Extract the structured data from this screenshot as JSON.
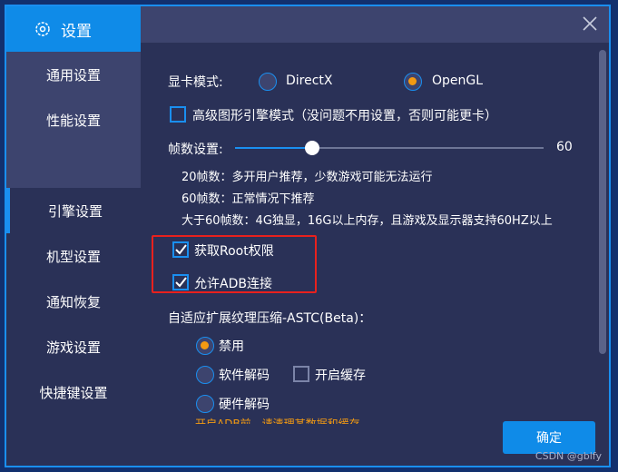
{
  "sidebar": {
    "title": "设置",
    "title_icon": "gear-icon",
    "items": [
      {
        "label": "通用设置"
      },
      {
        "label": "性能设置"
      },
      {
        "label": "引擎设置",
        "selected": true
      },
      {
        "label": "机型设置"
      },
      {
        "label": "通知恢复"
      },
      {
        "label": "游戏设置"
      },
      {
        "label": "快捷键设置"
      }
    ]
  },
  "main": {
    "gpu_mode": {
      "label": "显卡模式:",
      "options": [
        "DirectX",
        "OpenGL"
      ],
      "selected": "OpenGL"
    },
    "advanced_engine": {
      "label": "高级图形引擎模式（没问题不用设置，否则可能更卡）",
      "checked": false
    },
    "fps": {
      "label": "帧数设置:",
      "value": "60",
      "notes": [
        "20帧数：多开用户推荐，少数游戏可能无法运行",
        "60帧数：正常情况下推荐",
        "大于60帧数：4G独显，16G以上内存，且游戏及显示器支持60HZ以上"
      ]
    },
    "root": {
      "label": "获取Root权限",
      "checked": true
    },
    "adb": {
      "label": "允许ADB连接",
      "checked": true
    },
    "astc": {
      "label": "自适应扩展纹理压缩-ASTC(Beta)：",
      "options": [
        "禁用",
        "软件解码",
        "硬件解码"
      ],
      "selected": "禁用",
      "cache": {
        "label": "开启缓存",
        "checked": false
      }
    },
    "warning": "开启ADB前，请清理某数据和缓存",
    "confirm": "确定"
  },
  "colors": {
    "accent": "#0f8be8",
    "highlight": "#e8211d",
    "radio_on": "#f39a12"
  },
  "watermark": "CSDN @gblfy"
}
